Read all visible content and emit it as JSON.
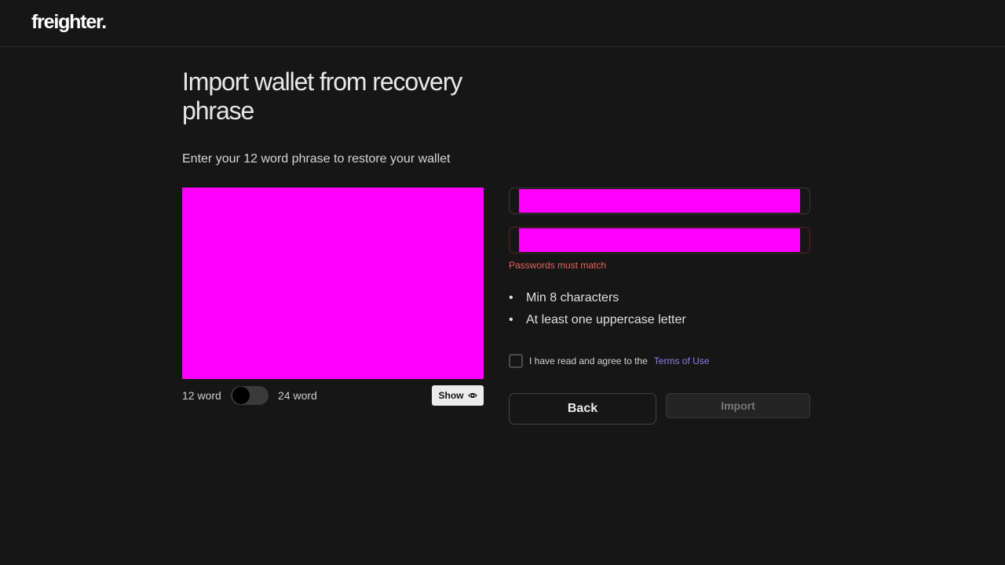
{
  "header": {
    "logo_text": "freighter."
  },
  "main": {
    "title": "Import wallet from recovery phrase",
    "subtitle": "Enter your 12 word phrase to restore your wallet",
    "phrase_toggle": {
      "left_label": "12 word",
      "right_label": "24 word",
      "selected": "12 word"
    },
    "show_button": {
      "label": "Show",
      "icon": "eye-icon"
    }
  },
  "form": {
    "password_error": "Passwords must match",
    "rules": [
      "Min 8 characters",
      "At least one uppercase letter"
    ],
    "terms": {
      "text": "I have read and agree to the",
      "link": "Terms of Use",
      "checked": false
    },
    "back_label": "Back",
    "import_label": "Import"
  },
  "colors": {
    "background": "#161616",
    "error": "#e5645c",
    "link": "#8e7fe8"
  }
}
